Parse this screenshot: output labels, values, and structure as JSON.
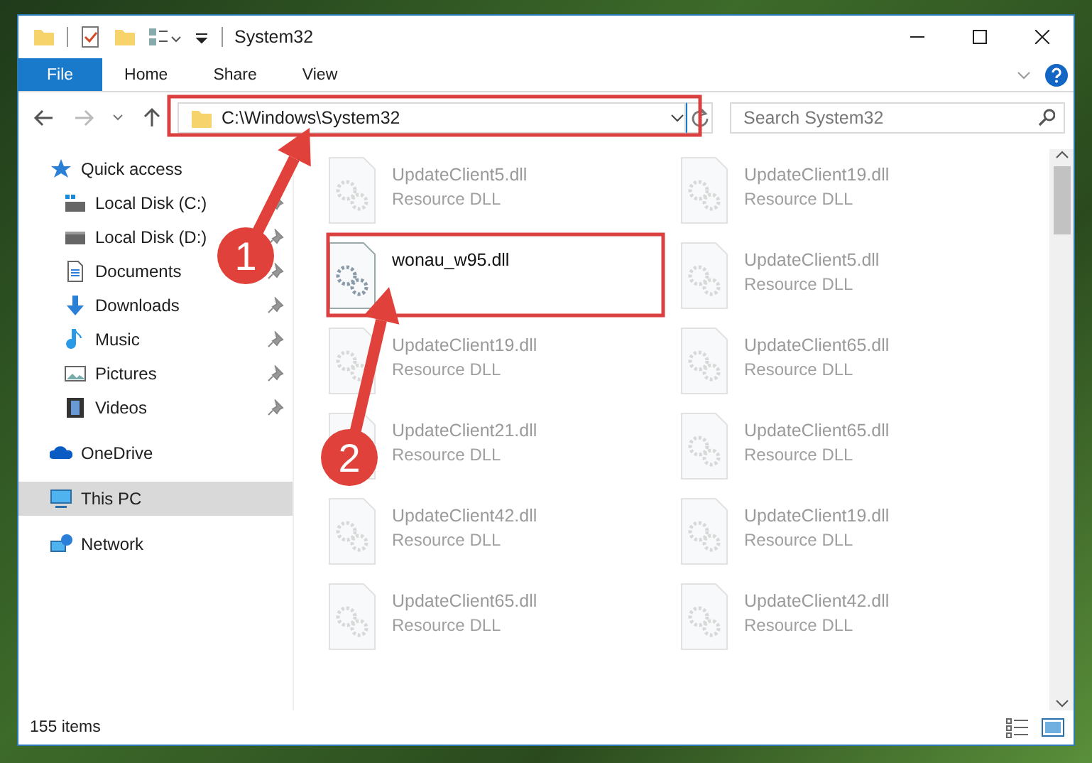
{
  "window": {
    "title": "System32"
  },
  "ribbon_tabs": [
    {
      "label": "File",
      "kind": "file"
    },
    {
      "label": "Home",
      "kind": "tab"
    },
    {
      "label": "Share",
      "kind": "tab"
    },
    {
      "label": "View",
      "kind": "tab"
    }
  ],
  "address": {
    "path": "C:\\Windows\\System32",
    "highlighted": true
  },
  "search": {
    "placeholder": "Search System32"
  },
  "nav": [
    {
      "label": "Quick access",
      "selected": false,
      "children": [
        {
          "label": "Local Disk (C:)",
          "pinned": true,
          "selected": false
        },
        {
          "label": "Local Disk (D:)",
          "pinned": true,
          "selected": false
        },
        {
          "label": "Documents",
          "pinned": true,
          "selected": false
        },
        {
          "label": "Downloads",
          "pinned": true,
          "selected": false
        },
        {
          "label": "Music",
          "pinned": true,
          "selected": false
        },
        {
          "label": "Pictures",
          "pinned": true,
          "selected": false
        },
        {
          "label": "Videos",
          "pinned": true,
          "selected": false
        }
      ]
    },
    {
      "label": "OneDrive",
      "selected": false
    },
    {
      "label": "This PC",
      "selected": true
    },
    {
      "label": "Network",
      "selected": false
    }
  ],
  "files": [
    {
      "name": "UpdateClient5.dll",
      "type": "Resource DLL",
      "dimmed": true,
      "highlighted": false
    },
    {
      "name": "UpdateClient19.dll",
      "type": "Resource DLL",
      "dimmed": true,
      "highlighted": false
    },
    {
      "name": "wonau_w95.dll",
      "dimmed": false,
      "highlighted": true
    },
    {
      "name": "UpdateClient5.dll",
      "type": "Resource DLL",
      "dimmed": true,
      "highlighted": false
    },
    {
      "name": "UpdateClient19.dll",
      "type": "Resource DLL",
      "dimmed": true,
      "highlighted": false
    },
    {
      "name": "UpdateClient65.dll",
      "type": "Resource DLL",
      "dimmed": true,
      "highlighted": false
    },
    {
      "name": "UpdateClient21.dll",
      "type": "Resource DLL",
      "dimmed": true,
      "highlighted": false
    },
    {
      "name": "UpdateClient65.dll",
      "type": "Resource DLL",
      "dimmed": true,
      "highlighted": false
    },
    {
      "name": "UpdateClient42.dll",
      "type": "Resource DLL",
      "dimmed": true,
      "highlighted": false
    },
    {
      "name": "UpdateClient19.dll",
      "type": "Resource DLL",
      "dimmed": true,
      "highlighted": false
    },
    {
      "name": "UpdateClient65.dll",
      "type": "Resource DLL",
      "dimmed": true,
      "highlighted": false
    },
    {
      "name": "UpdateClient42.dll",
      "type": "Resource DLL",
      "dimmed": true,
      "highlighted": false
    }
  ],
  "callouts": [
    {
      "number": "1"
    },
    {
      "number": "2"
    }
  ],
  "status_bar": {
    "count": "155 items"
  }
}
